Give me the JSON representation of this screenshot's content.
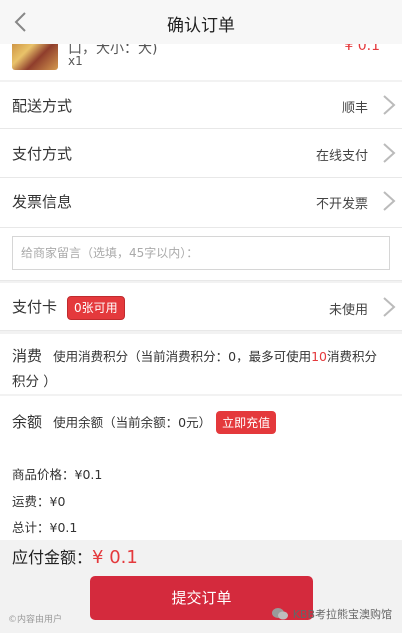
{
  "header": {
    "title": "确认订单"
  },
  "product": {
    "name": "口，大小：大)",
    "qty": "x1",
    "price": "¥ 0.1"
  },
  "rows": {
    "delivery": {
      "label": "配送方式",
      "value": "顺丰"
    },
    "payment": {
      "label": "支付方式",
      "value": "在线支付"
    },
    "invoice": {
      "label": "发票信息",
      "value": "不开发票"
    }
  },
  "note": {
    "placeholder": "给商家留言（选填，45字以内）："
  },
  "card": {
    "label": "支付卡",
    "badge": "0张可用",
    "value": "未使用"
  },
  "points": {
    "label": "消费",
    "text_a": "使用消费积分（当前消费积分：0，最多可使用",
    "max": "10",
    "text_b": "消费积分",
    "text_c": "积分 ）"
  },
  "balance": {
    "label": "余额",
    "text": "使用余额（当前余额：0元）",
    "recharge": "立即充值"
  },
  "summary": {
    "goods_price": "商品价格：¥0.1",
    "shipping": "运费：¥0",
    "subtotal": "总计：¥0.1"
  },
  "total": {
    "label": "应付金额：",
    "value": "¥ 0.1"
  },
  "submit_label": "提交订单",
  "watermark": {
    "left": "©内容由用户",
    "right": "KBB考拉熊宝澳购馆"
  },
  "colors": {
    "accent": "#e4393c",
    "button": "#d42a3d"
  }
}
